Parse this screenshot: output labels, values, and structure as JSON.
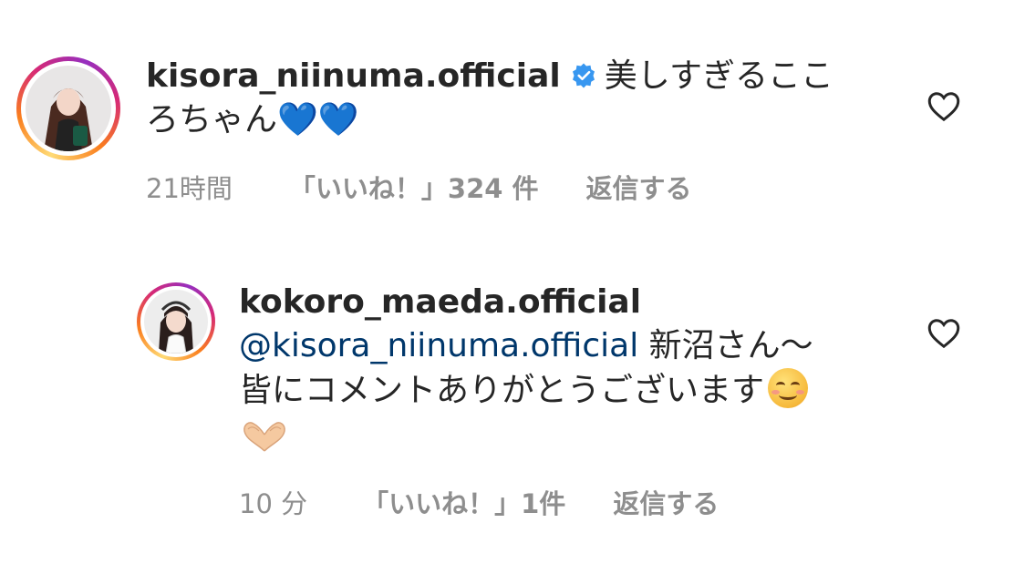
{
  "comments": [
    {
      "username": "kisora_niinuma.official",
      "verified": true,
      "text_line1": "美しすぎるここ",
      "text_line2": "ろちゃん",
      "emoji": "💙💙",
      "time": "21時間",
      "likes": "「いいね！」324 件",
      "reply": "返信する",
      "avatar_icon": "profile-photo"
    },
    {
      "username": "kokoro_maeda.official",
      "mention": "@kisora_niinuma.official",
      "text_line1_rest": " 新沼さん〜",
      "text_line2": "皆にコメントありがとうございます",
      "emoji_end": "☺️",
      "emoji_line3": "🫶",
      "time": "10 分",
      "likes": "「いいね！」1件",
      "reply": "返信する",
      "avatar_icon": "profile-photo"
    }
  ],
  "colors": {
    "text": "#262626",
    "meta": "#8e8e8e",
    "mention": "#00376b",
    "verified": "#3897f0"
  }
}
